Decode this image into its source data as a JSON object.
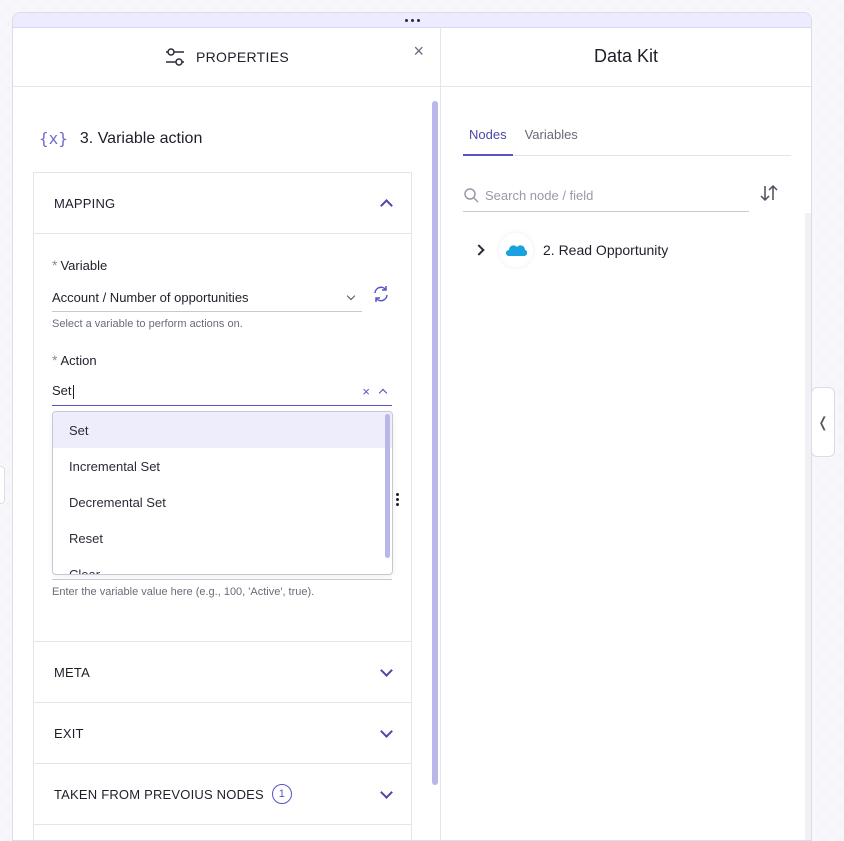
{
  "properties_panel": {
    "title": "PROPERTIES",
    "step_icon": "{x}",
    "step_title": "3. Variable action",
    "mapping": {
      "header": "MAPPING",
      "variable_label": "Variable",
      "variable_value": "Account / Number of opportunities",
      "variable_hint": "Select a variable to perform actions on.",
      "action_label": "Action",
      "action_value": "Set",
      "action_clear": "×",
      "action_options": [
        "Set",
        "Incremental Set",
        "Decremental Set",
        "Reset",
        "Clear"
      ],
      "value_hint": "Enter the variable value here (e.g., 100, 'Active', true)."
    },
    "sections": {
      "meta": "META",
      "exit": "EXIT",
      "taken": "TAKEN FROM PREVOIUS NODES",
      "taken_count": "1"
    },
    "close": "×"
  },
  "data_kit": {
    "title": "Data Kit",
    "tabs": [
      "Nodes",
      "Variables"
    ],
    "active_tab": "Nodes",
    "search_placeholder": "Search node / field",
    "nodes": [
      {
        "label": "2. Read Opportunity",
        "icon": "salesforce-cloud-icon"
      }
    ]
  },
  "side_tab_glyph": "❬",
  "colors": {
    "accent": "#5753c9",
    "accent_light": "#eeedfb",
    "salesforce": "#1ba0e0"
  }
}
